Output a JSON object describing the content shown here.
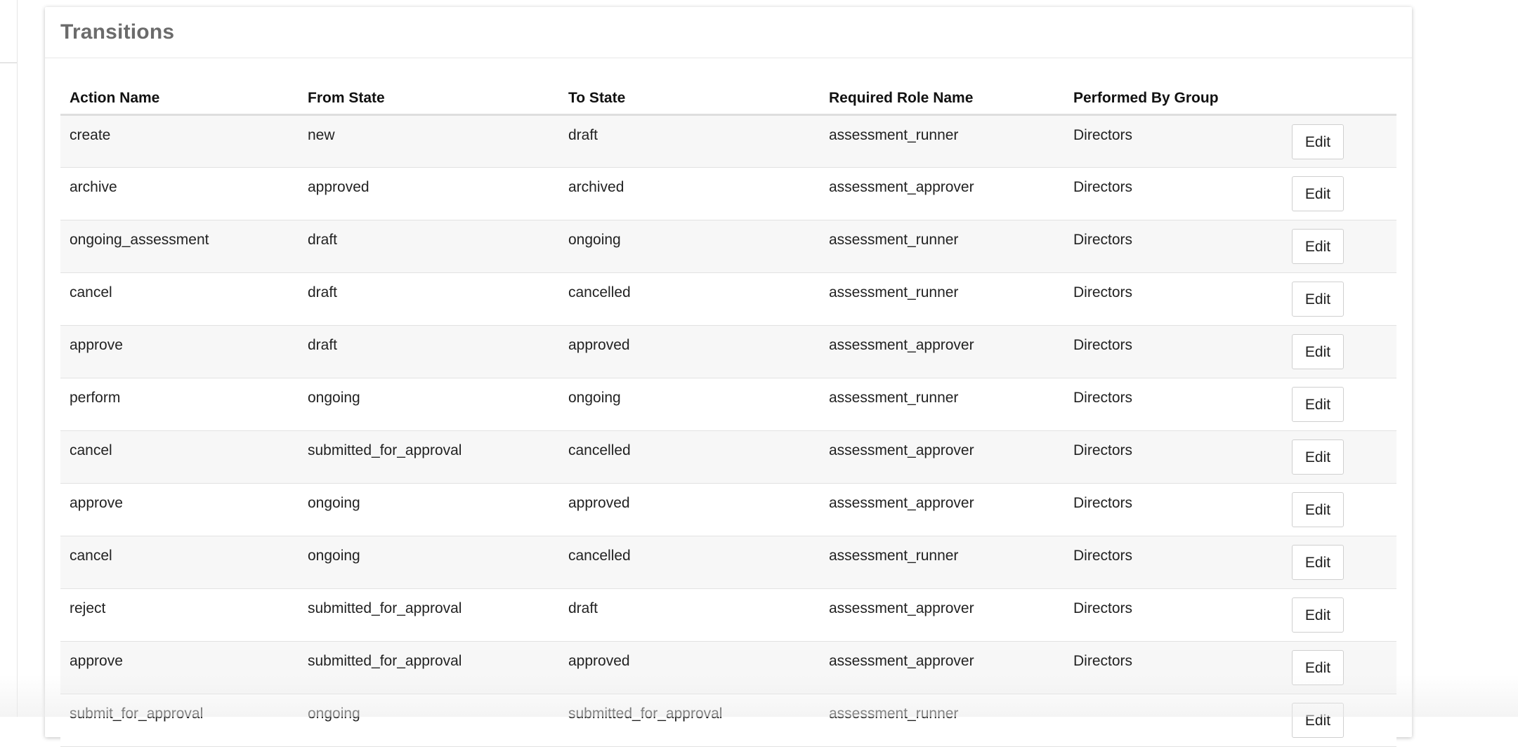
{
  "panel": {
    "title": "Transitions"
  },
  "table": {
    "headers": {
      "action_name": "Action Name",
      "from_state": "From State",
      "to_state": "To State",
      "required_role": "Required Role Name",
      "performed_by": "Performed By Group"
    },
    "edit_label": "Edit",
    "rows": [
      {
        "action": "create",
        "from": "new",
        "to": "draft",
        "role": "assessment_runner",
        "group": "Directors"
      },
      {
        "action": "archive",
        "from": "approved",
        "to": "archived",
        "role": "assessment_approver",
        "group": "Directors"
      },
      {
        "action": "ongoing_assessment",
        "from": "draft",
        "to": "ongoing",
        "role": "assessment_runner",
        "group": "Directors"
      },
      {
        "action": "cancel",
        "from": "draft",
        "to": "cancelled",
        "role": "assessment_runner",
        "group": "Directors"
      },
      {
        "action": "approve",
        "from": "draft",
        "to": "approved",
        "role": "assessment_approver",
        "group": "Directors"
      },
      {
        "action": "perform",
        "from": "ongoing",
        "to": "ongoing",
        "role": "assessment_runner",
        "group": "Directors"
      },
      {
        "action": "cancel",
        "from": "submitted_for_approval",
        "to": "cancelled",
        "role": "assessment_approver",
        "group": "Directors"
      },
      {
        "action": "approve",
        "from": "ongoing",
        "to": "approved",
        "role": "assessment_approver",
        "group": "Directors"
      },
      {
        "action": "cancel",
        "from": "ongoing",
        "to": "cancelled",
        "role": "assessment_runner",
        "group": "Directors"
      },
      {
        "action": "reject",
        "from": "submitted_for_approval",
        "to": "draft",
        "role": "assessment_approver",
        "group": "Directors"
      },
      {
        "action": "approve",
        "from": "submitted_for_approval",
        "to": "approved",
        "role": "assessment_approver",
        "group": "Directors"
      },
      {
        "action": "submit_for_approval",
        "from": "ongoing",
        "to": "submitted_for_approval",
        "role": "assessment_runner",
        "group": ""
      }
    ]
  }
}
